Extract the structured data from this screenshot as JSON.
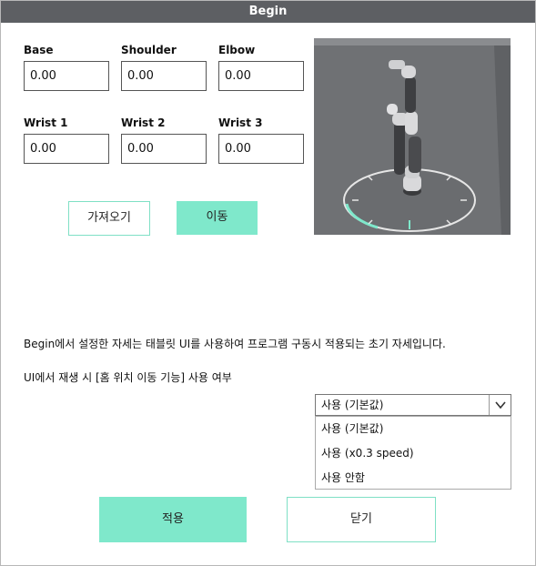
{
  "window": {
    "title": "Begin"
  },
  "joints": {
    "base": {
      "label": "Base",
      "value": "0.00"
    },
    "shoulder": {
      "label": "Shoulder",
      "value": "0.00"
    },
    "elbow": {
      "label": "Elbow",
      "value": "0.00"
    },
    "wrist1": {
      "label": "Wrist 1",
      "value": "0.00"
    },
    "wrist2": {
      "label": "Wrist 2",
      "value": "0.00"
    },
    "wrist3": {
      "label": "Wrist 3",
      "value": "0.00"
    }
  },
  "actions": {
    "fetch_label": "가져오기",
    "move_label": "이동"
  },
  "viewport": {
    "icon": "robot-arm-3d-view",
    "background": "#6d6f72",
    "floor_ring_color": "#7fe8cb"
  },
  "description": "Begin에서 설정한 자세는 태블릿 UI를 사용하여 프로그램 구동시 적용되는 초기 자세입니다.",
  "home_move": {
    "label": "UI에서 재생 시 [홈 위치 이동 기능] 사용 여부",
    "selected": "사용 (기본값)",
    "options": [
      "사용 (기본값)",
      "사용 (x0.3 speed)",
      "사용 안함"
    ]
  },
  "footer": {
    "apply_label": "적용",
    "close_label": "닫기"
  },
  "colors": {
    "accent": "#7fe8cb",
    "titlebar": "#5d5f63"
  }
}
